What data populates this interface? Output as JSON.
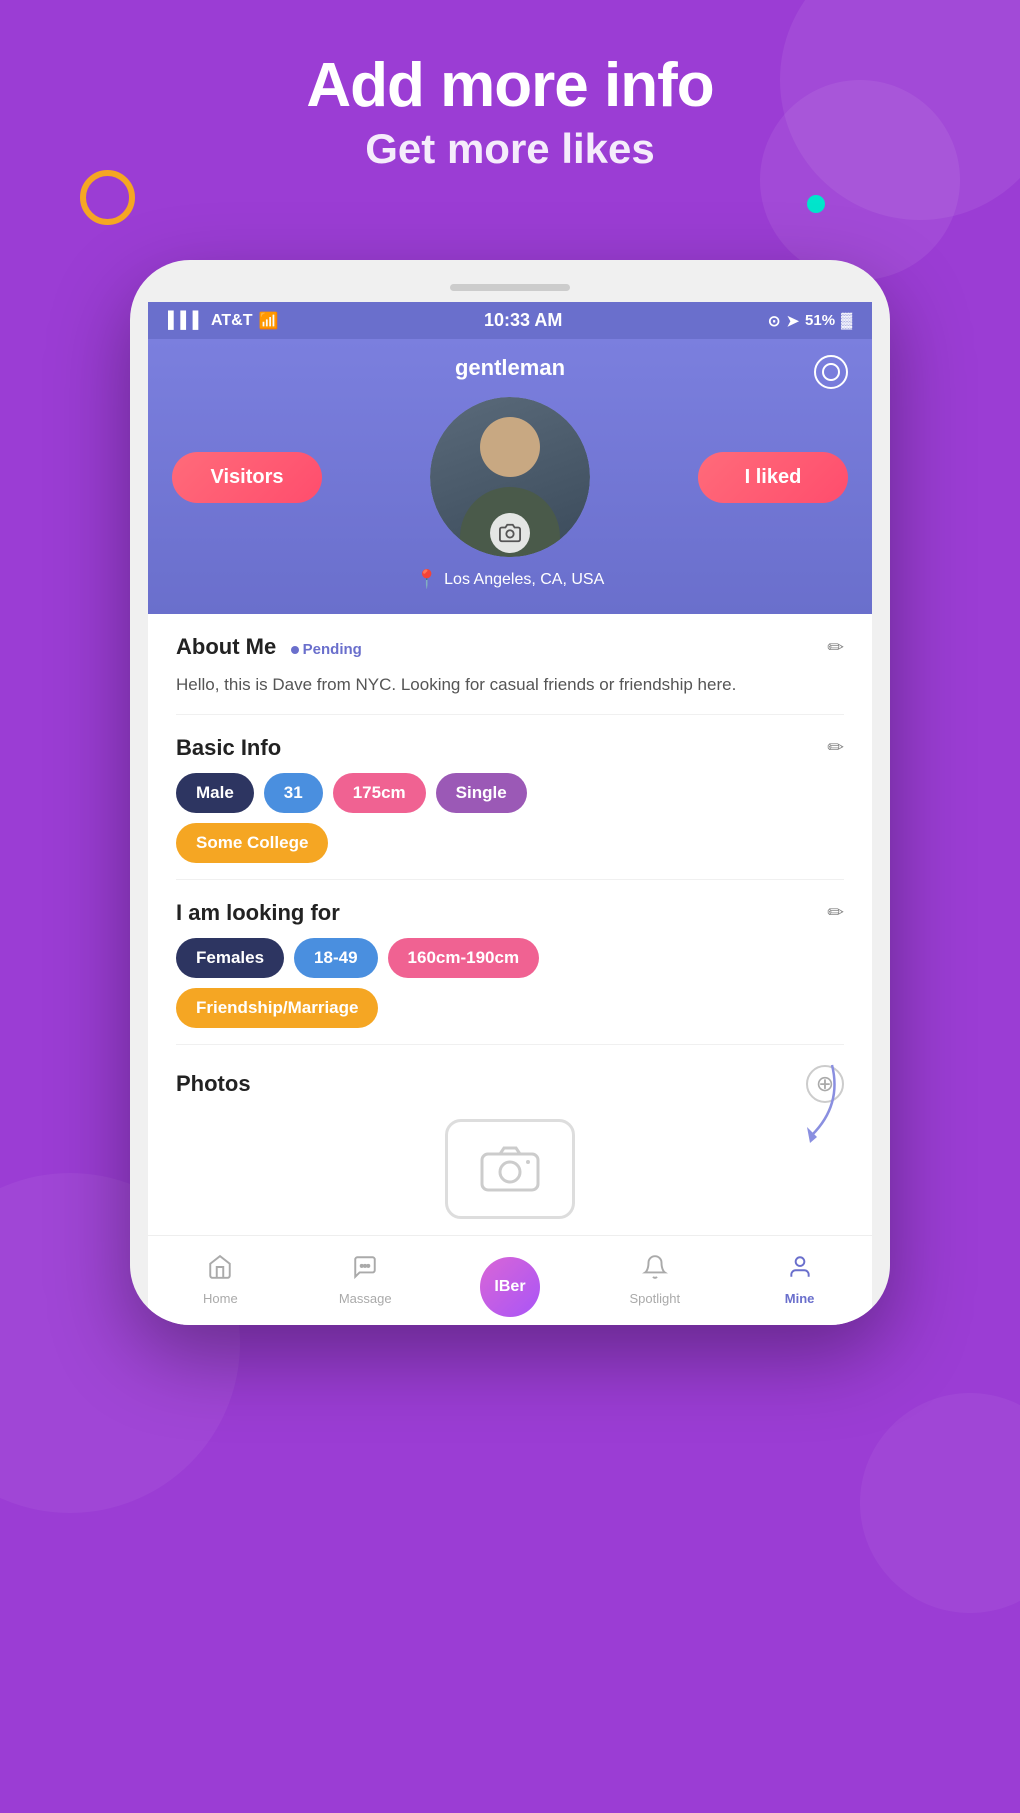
{
  "header": {
    "title": "Add more info",
    "subtitle": "Get more likes"
  },
  "phone": {
    "status_bar": {
      "carrier": "AT&T",
      "time": "10:33 AM",
      "battery": "51%"
    },
    "profile": {
      "username": "gentleman",
      "visitors_label": "Visitors",
      "liked_label": "I liked",
      "location": "Los Angeles, CA, USA",
      "about_me": {
        "title": "About Me",
        "pending": "Pending",
        "text": "Hello, this is Dave from NYC. Looking for casual friends or friendship here."
      },
      "basic_info": {
        "title": "Basic Info",
        "tags": [
          {
            "label": "Male",
            "style": "dark"
          },
          {
            "label": "31",
            "style": "blue"
          },
          {
            "label": "175cm",
            "style": "pink"
          },
          {
            "label": "Single",
            "style": "purple"
          },
          {
            "label": "Some College",
            "style": "orange"
          }
        ]
      },
      "looking_for": {
        "title": "I am looking for",
        "tags": [
          {
            "label": "Females",
            "style": "dark"
          },
          {
            "label": "18-49",
            "style": "blue"
          },
          {
            "label": "160cm-190cm",
            "style": "pink"
          },
          {
            "label": "Friendship/Marriage",
            "style": "orange"
          }
        ]
      },
      "photos": {
        "title": "Photos"
      }
    },
    "nav": {
      "items": [
        {
          "label": "Home",
          "icon": "🏠",
          "active": false
        },
        {
          "label": "Massage",
          "icon": "💬",
          "active": false
        },
        {
          "label": "IBer",
          "icon": "IBer",
          "active": false,
          "special": true
        },
        {
          "label": "Spotlight",
          "icon": "🔔",
          "active": false
        },
        {
          "label": "Mine",
          "icon": "👤",
          "active": true
        }
      ]
    }
  }
}
